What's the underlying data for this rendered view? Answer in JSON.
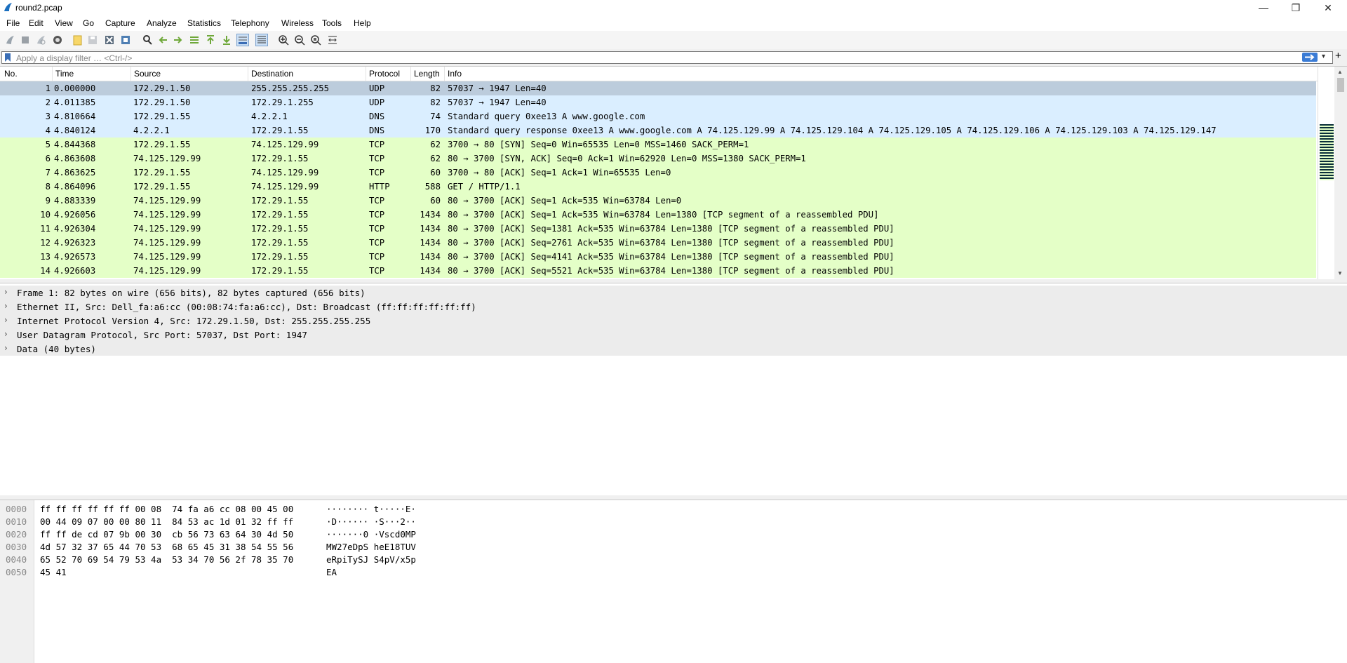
{
  "window": {
    "title": "round2.pcap"
  },
  "menu": [
    "File",
    "Edit",
    "View",
    "Go",
    "Capture",
    "Analyze",
    "Statistics",
    "Telephony",
    "Wireless",
    "Tools",
    "Help"
  ],
  "toolbar_icons": [
    "start-capture",
    "stop-capture",
    "restart-capture",
    "capture-options",
    "open-file",
    "save-file",
    "close-file",
    "reload-file",
    "find-packet",
    "go-back",
    "go-forward",
    "go-to-packet",
    "go-first",
    "go-last",
    "autoscroll",
    "colorize",
    "zoom-in",
    "zoom-out",
    "zoom-normal",
    "resize-columns"
  ],
  "filter": {
    "placeholder": "Apply a display filter … <Ctrl-/>",
    "add": "+"
  },
  "packet_list": {
    "columns": [
      "No.",
      "Time",
      "Source",
      "Destination",
      "Protocol",
      "Length",
      "Info"
    ],
    "rows": [
      {
        "no": "1",
        "time": "0.000000",
        "src": "172.29.1.50",
        "dst": "255.255.255.255",
        "proto": "UDP",
        "len": "82",
        "info": "57037 → 1947 Len=40",
        "bg": "#bcccdc"
      },
      {
        "no": "2",
        "time": "4.011385",
        "src": "172.29.1.50",
        "dst": "172.29.1.255",
        "proto": "UDP",
        "len": "82",
        "info": "57037 → 1947 Len=40",
        "bg": "#daeeff"
      },
      {
        "no": "3",
        "time": "4.810664",
        "src": "172.29.1.55",
        "dst": "4.2.2.1",
        "proto": "DNS",
        "len": "74",
        "info": "Standard query 0xee13 A www.google.com",
        "bg": "#daeeff"
      },
      {
        "no": "4",
        "time": "4.840124",
        "src": "4.2.2.1",
        "dst": "172.29.1.55",
        "proto": "DNS",
        "len": "170",
        "info": "Standard query response 0xee13 A www.google.com A 74.125.129.99 A 74.125.129.104 A 74.125.129.105 A 74.125.129.106 A 74.125.129.103 A 74.125.129.147",
        "bg": "#daeeff"
      },
      {
        "no": "5",
        "time": "4.844368",
        "src": "172.29.1.55",
        "dst": "74.125.129.99",
        "proto": "TCP",
        "len": "62",
        "info": "3700 → 80 [SYN] Seq=0 Win=65535 Len=0 MSS=1460 SACK_PERM=1",
        "bg": "#e4ffc7"
      },
      {
        "no": "6",
        "time": "4.863608",
        "src": "74.125.129.99",
        "dst": "172.29.1.55",
        "proto": "TCP",
        "len": "62",
        "info": "80 → 3700 [SYN, ACK] Seq=0 Ack=1 Win=62920 Len=0 MSS=1380 SACK_PERM=1",
        "bg": "#e4ffc7"
      },
      {
        "no": "7",
        "time": "4.863625",
        "src": "172.29.1.55",
        "dst": "74.125.129.99",
        "proto": "TCP",
        "len": "60",
        "info": "3700 → 80 [ACK] Seq=1 Ack=1 Win=65535 Len=0",
        "bg": "#e4ffc7"
      },
      {
        "no": "8",
        "time": "4.864096",
        "src": "172.29.1.55",
        "dst": "74.125.129.99",
        "proto": "HTTP",
        "len": "588",
        "info": "GET / HTTP/1.1",
        "bg": "#e4ffc7"
      },
      {
        "no": "9",
        "time": "4.883339",
        "src": "74.125.129.99",
        "dst": "172.29.1.55",
        "proto": "TCP",
        "len": "60",
        "info": "80 → 3700 [ACK] Seq=1 Ack=535 Win=63784 Len=0",
        "bg": "#e4ffc7"
      },
      {
        "no": "10",
        "time": "4.926056",
        "src": "74.125.129.99",
        "dst": "172.29.1.55",
        "proto": "TCP",
        "len": "1434",
        "info": "80 → 3700 [ACK] Seq=1 Ack=535 Win=63784 Len=1380 [TCP segment of a reassembled PDU]",
        "bg": "#e4ffc7"
      },
      {
        "no": "11",
        "time": "4.926304",
        "src": "74.125.129.99",
        "dst": "172.29.1.55",
        "proto": "TCP",
        "len": "1434",
        "info": "80 → 3700 [ACK] Seq=1381 Ack=535 Win=63784 Len=1380 [TCP segment of a reassembled PDU]",
        "bg": "#e4ffc7"
      },
      {
        "no": "12",
        "time": "4.926323",
        "src": "74.125.129.99",
        "dst": "172.29.1.55",
        "proto": "TCP",
        "len": "1434",
        "info": "80 → 3700 [ACK] Seq=2761 Ack=535 Win=63784 Len=1380 [TCP segment of a reassembled PDU]",
        "bg": "#e4ffc7"
      },
      {
        "no": "13",
        "time": "4.926573",
        "src": "74.125.129.99",
        "dst": "172.29.1.55",
        "proto": "TCP",
        "len": "1434",
        "info": "80 → 3700 [ACK] Seq=4141 Ack=535 Win=63784 Len=1380 [TCP segment of a reassembled PDU]",
        "bg": "#e4ffc7"
      },
      {
        "no": "14",
        "time": "4.926603",
        "src": "74.125.129.99",
        "dst": "172.29.1.55",
        "proto": "TCP",
        "len": "1434",
        "info": "80 → 3700 [ACK] Seq=5521 Ack=535 Win=63784 Len=1380 [TCP segment of a reassembled PDU]",
        "bg": "#e4ffc7"
      }
    ]
  },
  "details": [
    "Frame 1: 82 bytes on wire (656 bits), 82 bytes captured (656 bits)",
    "Ethernet II, Src: Dell_fa:a6:cc (00:08:74:fa:a6:cc), Dst: Broadcast (ff:ff:ff:ff:ff:ff)",
    "Internet Protocol Version 4, Src: 172.29.1.50, Dst: 255.255.255.255",
    "User Datagram Protocol, Src Port: 57037, Dst Port: 1947",
    "Data (40 bytes)"
  ],
  "bytes": [
    {
      "off": "0000",
      "hex": "ff ff ff ff ff ff 00 08  74 fa a6 cc 08 00 45 00",
      "ascii": "········ t·····E·"
    },
    {
      "off": "0010",
      "hex": "00 44 09 07 00 00 80 11  84 53 ac 1d 01 32 ff ff",
      "ascii": "·D······ ·S···2··"
    },
    {
      "off": "0020",
      "hex": "ff ff de cd 07 9b 00 30  cb 56 73 63 64 30 4d 50",
      "ascii": "·······0 ·Vscd0MP"
    },
    {
      "off": "0030",
      "hex": "4d 57 32 37 65 44 70 53  68 65 45 31 38 54 55 56",
      "ascii": "MW27eDpS heE18TUV"
    },
    {
      "off": "0040",
      "hex": "65 52 70 69 54 79 53 4a  53 34 70 56 2f 78 35 70",
      "ascii": "eRpiTySJ S4pV/x5p"
    },
    {
      "off": "0050",
      "hex": "45 41",
      "ascii": "EA"
    }
  ],
  "colors": {
    "selected_row": "#bcccdc",
    "udp_row": "#daeeff",
    "tcp_row": "#e4ffc7"
  }
}
